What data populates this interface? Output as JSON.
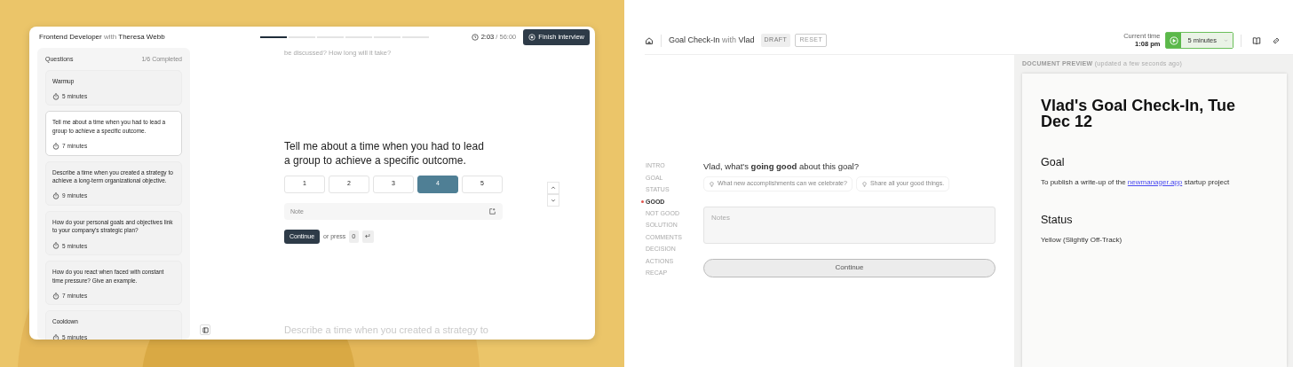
{
  "interview": {
    "title": "Frontend Developer",
    "with": "with",
    "candidate": "Theresa Webb",
    "progress": [
      {
        "done": true
      },
      {
        "done": false
      },
      {
        "done": false
      },
      {
        "done": false
      },
      {
        "done": false
      },
      {
        "done": false
      }
    ],
    "timer": {
      "elapsed": "2:03",
      "total": "/ 56:00"
    },
    "finish_button": "Finish interview",
    "sidebar": {
      "heading": "Questions",
      "count": "1/6 Completed",
      "items": [
        {
          "text": "Warmup",
          "duration": "5 minutes",
          "selected": false
        },
        {
          "text": "Tell me about a time when you had to lead a group to achieve a specific outcome.",
          "duration": "7 minutes",
          "selected": true
        },
        {
          "text": "Describe a time when you created a strategy to achieve a long-term organizational objective.",
          "duration": "9 minutes",
          "selected": false
        },
        {
          "text": "How do your personal goals and objectives link to your company's strategic plan?",
          "duration": "5 minutes",
          "selected": false
        },
        {
          "text": "How do you react when faced with constant time pressure? Give an example.",
          "duration": "7 minutes",
          "selected": false
        },
        {
          "text": "Cooldown",
          "duration": "5 minutes",
          "selected": false
        }
      ]
    },
    "previous_text": "be discussed? How long will it take?",
    "question": "Tell me about a time when you had to lead a group to achieve a specific outcome.",
    "ratings": [
      {
        "label": "1",
        "selected": false
      },
      {
        "label": "2",
        "selected": false
      },
      {
        "label": "3",
        "selected": false
      },
      {
        "label": "4",
        "selected": true
      },
      {
        "label": "5",
        "selected": false
      }
    ],
    "note_placeholder": "Note",
    "continue_button": "Continue",
    "hint": "or press",
    "keys": [
      "0",
      "↵"
    ],
    "next_text": "Describe a time when you created a strategy to"
  },
  "checkin": {
    "title": "Goal Check-In",
    "with": "with",
    "person": "Vlad",
    "badge": "DRAFT",
    "reset_button": "RESET",
    "time_label": "Current time",
    "time": "1:08 pm",
    "timer": "5 minutes",
    "steps": [
      {
        "label": "INTRO",
        "selected": false
      },
      {
        "label": "GOAL",
        "selected": false
      },
      {
        "label": "STATUS",
        "selected": false
      },
      {
        "label": "GOOD",
        "selected": true
      },
      {
        "label": "NOT GOOD",
        "selected": false
      },
      {
        "label": "SOLUTION",
        "selected": false
      },
      {
        "label": "COMMENTS",
        "selected": false
      },
      {
        "label": "DECISION",
        "selected": false
      },
      {
        "label": "ACTIONS",
        "selected": false
      },
      {
        "label": "RECAP",
        "selected": false
      }
    ],
    "question": "Vlad, what's **going good** about this goal?",
    "hints": [
      "What new accomplishments can we celebrate?",
      "Share all your good things."
    ],
    "notes_placeholder": "Notes",
    "continue_button": "Continue",
    "preview": {
      "label": "DOCUMENT PREVIEW",
      "note": "(updated a few seconds ago)",
      "title": "Vlad's Goal Check-In, Tue Dec 12",
      "sections": [
        {
          "heading": "Goal",
          "before": "To publish a write-up of the ",
          "link": "newmanager.app",
          "after": " startup project"
        },
        {
          "heading": "Status",
          "before": "Yellow (Slightly Off-Track)"
        }
      ]
    }
  }
}
